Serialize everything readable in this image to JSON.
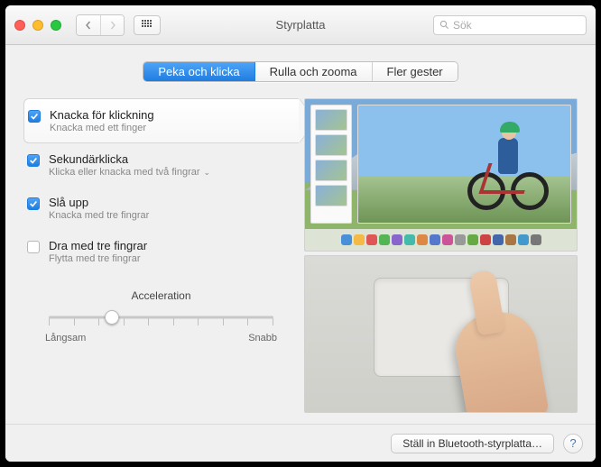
{
  "window": {
    "title": "Styrplatta"
  },
  "search": {
    "placeholder": "Sök"
  },
  "tabs": [
    {
      "label": "Peka och klicka",
      "active": true
    },
    {
      "label": "Rulla och zooma",
      "active": false
    },
    {
      "label": "Fler gester",
      "active": false
    }
  ],
  "options": [
    {
      "title": "Knacka för klickning",
      "sub": "Knacka med ett finger",
      "checked": true,
      "selected": true,
      "dropdown": false
    },
    {
      "title": "Sekundärklicka",
      "sub": "Klicka eller knacka med två fingrar",
      "checked": true,
      "selected": false,
      "dropdown": true
    },
    {
      "title": "Slå upp",
      "sub": "Knacka med tre fingrar",
      "checked": true,
      "selected": false,
      "dropdown": false
    },
    {
      "title": "Dra med tre fingrar",
      "sub": "Flytta med tre fingrar",
      "checked": false,
      "selected": false,
      "dropdown": false
    }
  ],
  "accel": {
    "label": "Acceleration",
    "slow": "Långsam",
    "fast": "Snabb",
    "ticks": 10,
    "valuePercent": 28
  },
  "footer": {
    "bluetooth": "Ställ in Bluetooth-styrplatta…",
    "help": "?"
  },
  "dockColors": [
    "#4a90d9",
    "#f5b945",
    "#e05555",
    "#55b555",
    "#8866cc",
    "#44bbaa",
    "#dd8844",
    "#5577cc",
    "#cc5599",
    "#999999",
    "#66aa44",
    "#cc4444",
    "#4466aa",
    "#aa7744",
    "#4499cc",
    "#777777"
  ]
}
